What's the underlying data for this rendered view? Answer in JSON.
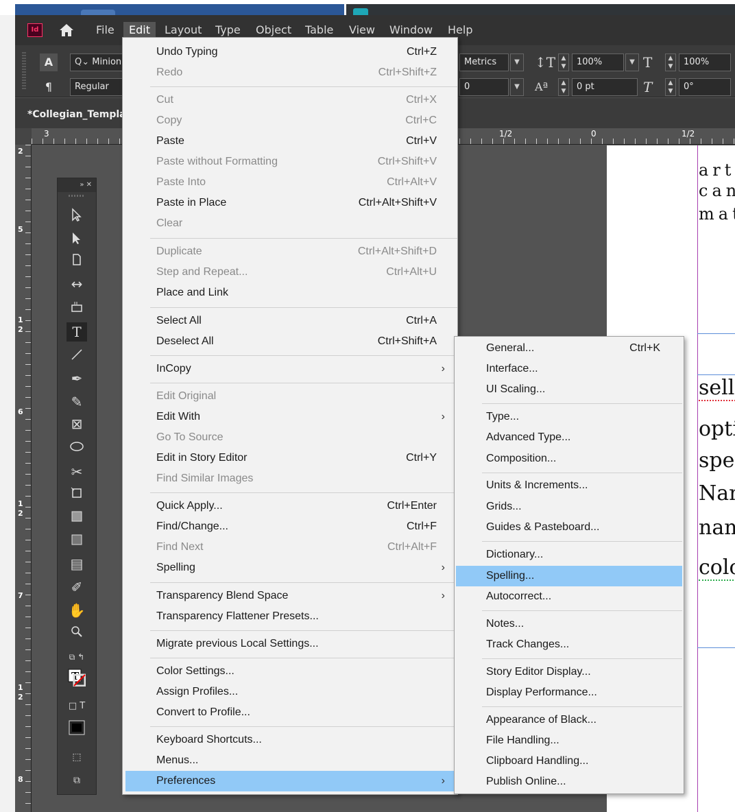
{
  "menubar": {
    "logo": "Id",
    "items": [
      "File",
      "Edit",
      "Layout",
      "Type",
      "Object",
      "Table",
      "View",
      "Window",
      "Help"
    ],
    "active": "Edit"
  },
  "control_panel": {
    "char_icon": "A",
    "para_icon": "¶",
    "font_family": "Minion",
    "font_style": "Regular",
    "kerning": "Metrics",
    "tracking": "0",
    "vertical_scale": "100%",
    "horizontal_scale": "100%",
    "baseline_shift": "0 pt",
    "skew": "0°"
  },
  "document": {
    "tab_title": "*Collegian_Templa",
    "ruler_h": [
      "3",
      "1/2",
      "0",
      "1/2"
    ],
    "ruler_v": [
      "2",
      "5",
      "1",
      "2",
      "6",
      "1",
      "2",
      "7",
      "1",
      "2",
      "8"
    ],
    "page_text_spaced": [
      "artic",
      "can-",
      "mat"
    ],
    "page_text_serif": [
      "selle",
      "optic",
      "spell",
      "Nam",
      "nam",
      "colo"
    ]
  },
  "edit_menu": {
    "items": [
      {
        "label": "Undo Typing",
        "shortcut": "Ctrl+Z",
        "enabled": true
      },
      {
        "label": "Redo",
        "shortcut": "Ctrl+Shift+Z",
        "enabled": false
      },
      {
        "label": "Cut",
        "shortcut": "Ctrl+X",
        "enabled": false
      },
      {
        "label": "Copy",
        "shortcut": "Ctrl+C",
        "enabled": false
      },
      {
        "label": "Paste",
        "shortcut": "Ctrl+V",
        "enabled": true
      },
      {
        "label": "Paste without Formatting",
        "shortcut": "Ctrl+Shift+V",
        "enabled": false
      },
      {
        "label": "Paste Into",
        "shortcut": "Ctrl+Alt+V",
        "enabled": false
      },
      {
        "label": "Paste in Place",
        "shortcut": "Ctrl+Alt+Shift+V",
        "enabled": true
      },
      {
        "label": "Clear",
        "shortcut": "",
        "enabled": false
      },
      {
        "label": "Duplicate",
        "shortcut": "Ctrl+Alt+Shift+D",
        "enabled": false
      },
      {
        "label": "Step and Repeat...",
        "shortcut": "Ctrl+Alt+U",
        "enabled": false
      },
      {
        "label": "Place and Link",
        "shortcut": "",
        "enabled": true
      },
      {
        "label": "Select All",
        "shortcut": "Ctrl+A",
        "enabled": true
      },
      {
        "label": "Deselect All",
        "shortcut": "Ctrl+Shift+A",
        "enabled": true
      },
      {
        "label": "InCopy",
        "shortcut": "",
        "enabled": true,
        "submenu": true
      },
      {
        "label": "Edit Original",
        "shortcut": "",
        "enabled": false
      },
      {
        "label": "Edit With",
        "shortcut": "",
        "enabled": true,
        "submenu": true
      },
      {
        "label": "Go To Source",
        "shortcut": "",
        "enabled": false
      },
      {
        "label": "Edit in Story Editor",
        "shortcut": "Ctrl+Y",
        "enabled": true
      },
      {
        "label": "Find Similar Images",
        "shortcut": "",
        "enabled": false
      },
      {
        "label": "Quick Apply...",
        "shortcut": "Ctrl+Enter",
        "enabled": true
      },
      {
        "label": "Find/Change...",
        "shortcut": "Ctrl+F",
        "enabled": true
      },
      {
        "label": "Find Next",
        "shortcut": "Ctrl+Alt+F",
        "enabled": false
      },
      {
        "label": "Spelling",
        "shortcut": "",
        "enabled": true,
        "submenu": true
      },
      {
        "label": "Transparency Blend Space",
        "shortcut": "",
        "enabled": true,
        "submenu": true
      },
      {
        "label": "Transparency Flattener Presets...",
        "shortcut": "",
        "enabled": true
      },
      {
        "label": "Migrate previous Local Settings...",
        "shortcut": "",
        "enabled": true
      },
      {
        "label": "Color Settings...",
        "shortcut": "",
        "enabled": true
      },
      {
        "label": "Assign Profiles...",
        "shortcut": "",
        "enabled": true
      },
      {
        "label": "Convert to Profile...",
        "shortcut": "",
        "enabled": true
      },
      {
        "label": "Keyboard Shortcuts...",
        "shortcut": "",
        "enabled": true
      },
      {
        "label": "Menus...",
        "shortcut": "",
        "enabled": true
      },
      {
        "label": "Preferences",
        "shortcut": "",
        "enabled": true,
        "submenu": true,
        "highlighted": true
      }
    ]
  },
  "preferences_menu": {
    "items": [
      {
        "label": "General...",
        "shortcut": "Ctrl+K"
      },
      {
        "label": "Interface...",
        "shortcut": ""
      },
      {
        "label": "UI Scaling...",
        "shortcut": ""
      },
      {
        "label": "Type...",
        "shortcut": ""
      },
      {
        "label": "Advanced Type...",
        "shortcut": ""
      },
      {
        "label": "Composition...",
        "shortcut": ""
      },
      {
        "label": "Units & Increments...",
        "shortcut": ""
      },
      {
        "label": "Grids...",
        "shortcut": ""
      },
      {
        "label": "Guides & Pasteboard...",
        "shortcut": ""
      },
      {
        "label": "Dictionary...",
        "shortcut": ""
      },
      {
        "label": "Spelling...",
        "shortcut": "",
        "highlighted": true
      },
      {
        "label": "Autocorrect...",
        "shortcut": ""
      },
      {
        "label": "Notes...",
        "shortcut": ""
      },
      {
        "label": "Track Changes...",
        "shortcut": ""
      },
      {
        "label": "Story Editor Display...",
        "shortcut": ""
      },
      {
        "label": "Display Performance...",
        "shortcut": ""
      },
      {
        "label": "Appearance of Black...",
        "shortcut": ""
      },
      {
        "label": "File Handling...",
        "shortcut": ""
      },
      {
        "label": "Clipboard Handling...",
        "shortcut": ""
      },
      {
        "label": "Publish Online...",
        "shortcut": ""
      }
    ]
  },
  "colors": {
    "menu_bg": "#f2f2f2",
    "highlight": "#91c9f7",
    "app_bg": "#535353",
    "indesign_brand": "#ff3366"
  }
}
